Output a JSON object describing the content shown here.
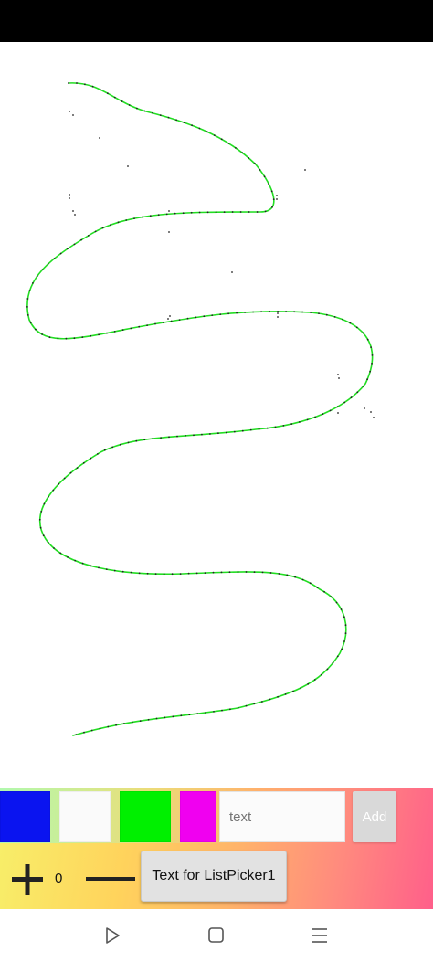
{
  "canvas": {
    "stroke_color": "#22dd22",
    "dot_color": "#222222"
  },
  "palette": {
    "swatches": [
      {
        "name": "blue",
        "color": "#0a14f0"
      },
      {
        "name": "white",
        "color": "#fafafa"
      },
      {
        "name": "green",
        "color": "#00f000"
      },
      {
        "name": "magenta",
        "color": "#f000f0"
      }
    ],
    "text_placeholder": "text",
    "text_value": "",
    "add_label": "Add"
  },
  "controls": {
    "counter_value": "0",
    "listpicker_label": "Text for ListPicker1"
  },
  "navigation": {
    "back_icon": "triangle-right-icon",
    "home_icon": "square-icon",
    "recents_icon": "menu-lines-icon"
  }
}
